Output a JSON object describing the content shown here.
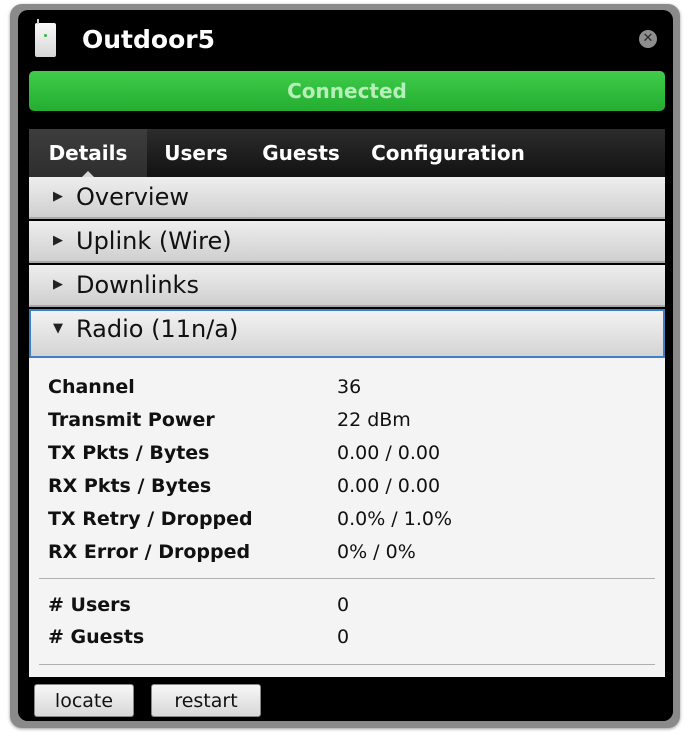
{
  "window": {
    "title": "Outdoor5",
    "icon": "access-point-icon",
    "close_icon": "close-icon"
  },
  "status": {
    "text": "Connected",
    "color": "#2fbb3b"
  },
  "tabs": [
    {
      "label": "Details",
      "active": true
    },
    {
      "label": "Users",
      "active": false
    },
    {
      "label": "Guests",
      "active": false
    },
    {
      "label": "Configuration",
      "active": false
    }
  ],
  "sections": [
    {
      "label": "Overview",
      "expanded": false
    },
    {
      "label": "Uplink (Wire)",
      "expanded": false
    },
    {
      "label": "Downlinks",
      "expanded": false
    },
    {
      "label": "Radio (11n/a)",
      "expanded": true
    }
  ],
  "radio_details": [
    {
      "key": "Channel",
      "value": "36"
    },
    {
      "key": "Transmit Power",
      "value": "22 dBm"
    },
    {
      "key": "TX Pkts / Bytes",
      "value": "0.00 / 0.00"
    },
    {
      "key": "RX Pkts / Bytes",
      "value": "0.00 / 0.00"
    },
    {
      "key": "TX Retry / Dropped",
      "value": "0.0% / 1.0%"
    },
    {
      "key": "RX Error / Dropped",
      "value": "0% / 0%"
    }
  ],
  "client_counts": [
    {
      "key": "# Users",
      "value": "0"
    },
    {
      "key": "# Guests",
      "value": "0"
    }
  ],
  "footer": {
    "locate_label": "locate",
    "restart_label": "restart"
  },
  "colors": {
    "accent_border": "#3f7fc4",
    "status_green": "#2fbb3b"
  }
}
